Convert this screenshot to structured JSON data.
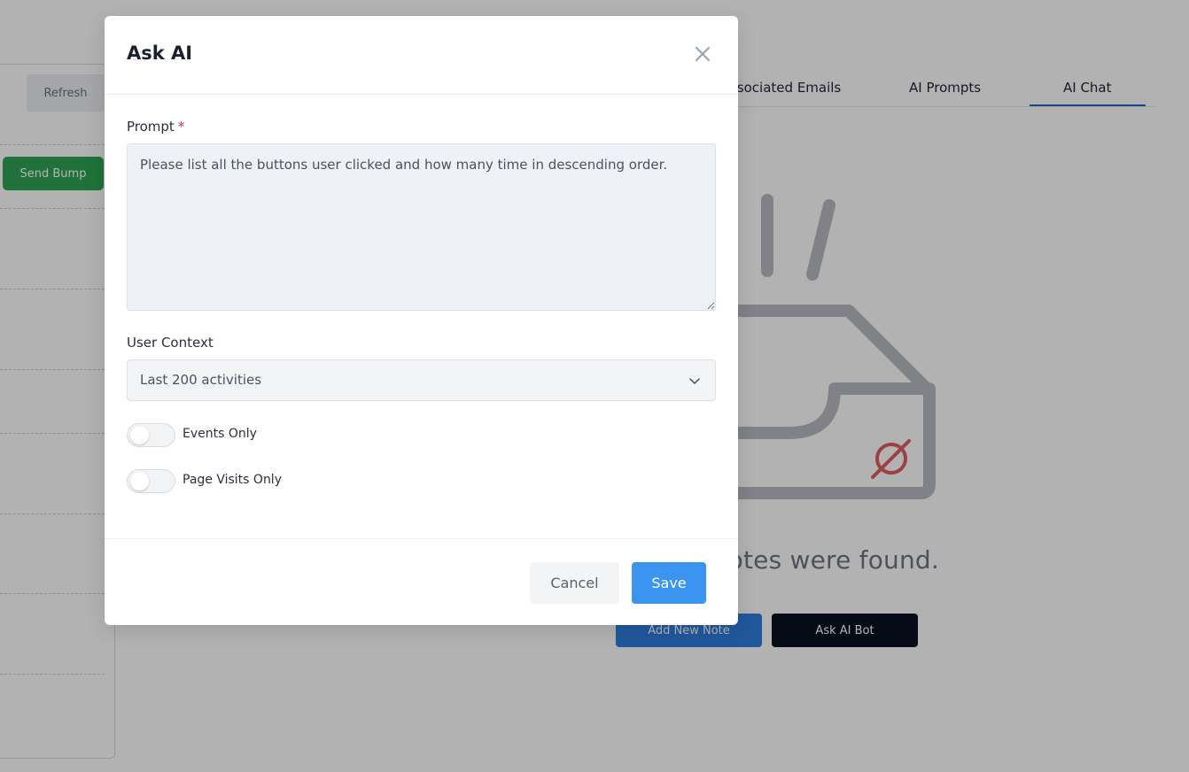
{
  "background": {
    "refresh_label": "Refresh",
    "send_bump_label": "Send Bump",
    "tabs": [
      {
        "label": "ssociated Emails"
      },
      {
        "label": "AI Prompts"
      },
      {
        "label": "AI Chat",
        "active": true
      }
    ],
    "empty_state_text": "otes were found.",
    "add_note_label": "Add New Note",
    "ask_bot_label": "Ask AI Bot",
    "icon": "empty-inbox-icon"
  },
  "modal": {
    "title": "Ask AI",
    "prompt_label": "Prompt",
    "required_marker": "*",
    "prompt_value": "Please list all the buttons user clicked and how many time in descending order.",
    "context_label": "User Context",
    "context_value": "Last 200 activities",
    "toggles": [
      {
        "label": "Events Only",
        "checked": false
      },
      {
        "label": "Page Visits Only",
        "checked": false
      }
    ],
    "cancel_label": "Cancel",
    "save_label": "Save"
  },
  "colors": {
    "primary": "#3b95f0",
    "success": "#2fa454",
    "dark": "#0b1120",
    "required": "#e0245e",
    "tab_active": "#2563c9"
  }
}
